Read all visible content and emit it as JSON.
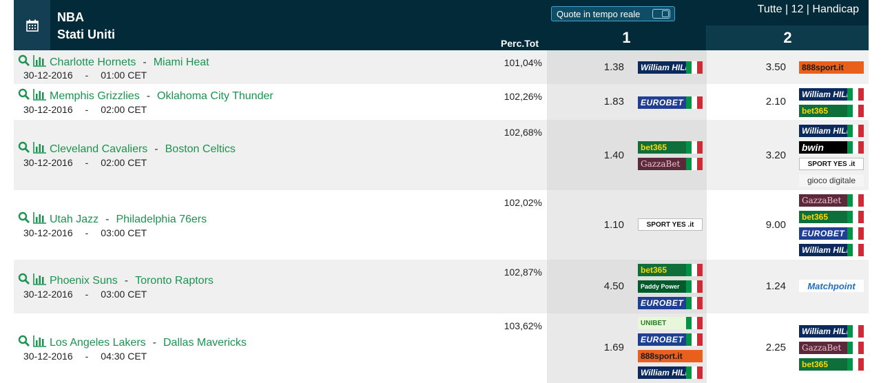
{
  "header": {
    "league": "NBA",
    "country": "Stati Uniti",
    "perc_label": "Perc.Tot",
    "live_button": "Quote in tempo reale",
    "filters": "Tutte | 12 | Handicap",
    "col1": "1",
    "col2": "2",
    "calendar_icon": "calendar-icon"
  },
  "colors": {
    "header_bg": "#032a38",
    "team_link": "#1a9450"
  },
  "matches": [
    {
      "home": "Charlotte Hornets",
      "away": "Miami Heat",
      "dash": "-",
      "date": "30-12-2016",
      "time": "01:00 CET",
      "perc": "101,04%",
      "odd1": "1.38",
      "odd2": "3.50",
      "books1": [
        {
          "key": "wh",
          "label": "William HILL"
        }
      ],
      "books2": [
        {
          "key": "b888",
          "label": "888sport.it"
        }
      ]
    },
    {
      "home": "Memphis Grizzlies",
      "away": "Oklahoma City Thunder",
      "dash": "-",
      "date": "30-12-2016",
      "time": "02:00 CET",
      "perc": "102,26%",
      "odd1": "1.83",
      "odd2": "2.10",
      "books1": [
        {
          "key": "eb",
          "label": "EUROBET"
        }
      ],
      "books2": [
        {
          "key": "wh",
          "label": "William HILL"
        },
        {
          "key": "b365",
          "label": "bet365"
        }
      ]
    },
    {
      "home": "Cleveland Cavaliers",
      "away": "Boston Celtics",
      "dash": "-",
      "date": "30-12-2016",
      "time": "02:00 CET",
      "perc": "102,68%",
      "odd1": "1.40",
      "odd2": "3.20",
      "books1": [
        {
          "key": "b365",
          "label": "bet365"
        },
        {
          "key": "gb",
          "label": "GazzaBet"
        }
      ],
      "books2": [
        {
          "key": "wh",
          "label": "William HILL"
        },
        {
          "key": "bwin",
          "label": "bwin"
        },
        {
          "key": "sport",
          "label": "SPORT YES .it"
        },
        {
          "key": "gioco",
          "label": "gioco digitale"
        }
      ]
    },
    {
      "home": "Utah Jazz",
      "away": "Philadelphia 76ers",
      "dash": "-",
      "date": "30-12-2016",
      "time": "03:00 CET",
      "perc": "102,02%",
      "odd1": "1.10",
      "odd2": "9.00",
      "books1": [
        {
          "key": "sport",
          "label": "SPORT YES .it"
        }
      ],
      "books2": [
        {
          "key": "gb",
          "label": "GazzaBet"
        },
        {
          "key": "b365",
          "label": "bet365"
        },
        {
          "key": "eb",
          "label": "EUROBET"
        },
        {
          "key": "wh",
          "label": "William HILL"
        }
      ]
    },
    {
      "home": "Phoenix Suns",
      "away": "Toronto Raptors",
      "dash": "-",
      "date": "30-12-2016",
      "time": "03:00 CET",
      "perc": "102,87%",
      "odd1": "4.50",
      "odd2": "1.24",
      "books1": [
        {
          "key": "b365",
          "label": "bet365"
        },
        {
          "key": "paddy",
          "label": "Paddy Power"
        },
        {
          "key": "eb",
          "label": "EUROBET"
        }
      ],
      "books2": [
        {
          "key": "match-p",
          "label": "Matchpoint"
        }
      ]
    },
    {
      "home": "Los Angeles Lakers",
      "away": "Dallas Mavericks",
      "dash": "-",
      "date": "30-12-2016",
      "time": "04:30 CET",
      "perc": "103,62%",
      "odd1": "1.69",
      "odd2": "2.25",
      "books1": [
        {
          "key": "unibet",
          "label": "UNIBET"
        },
        {
          "key": "eb",
          "label": "EUROBET"
        },
        {
          "key": "b888",
          "label": "888sport.it"
        },
        {
          "key": "wh",
          "label": "William HILL"
        }
      ],
      "books2": [
        {
          "key": "wh",
          "label": "William HILL"
        },
        {
          "key": "gb",
          "label": "GazzaBet"
        },
        {
          "key": "b365",
          "label": "bet365"
        }
      ]
    }
  ]
}
